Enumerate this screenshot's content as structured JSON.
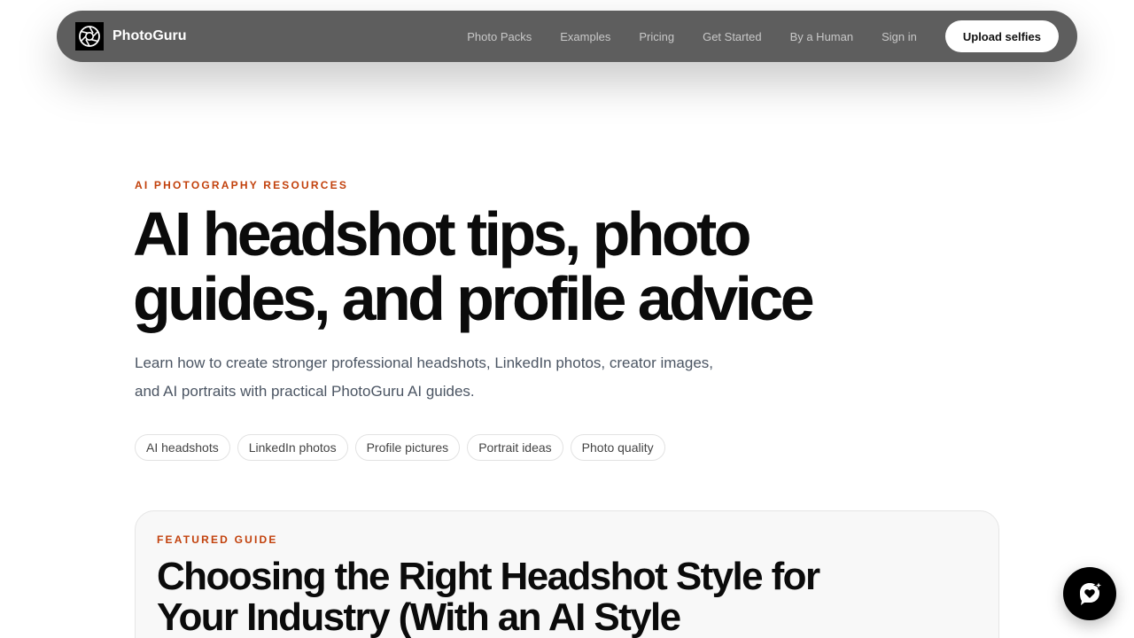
{
  "nav": {
    "brand": "PhotoGuru",
    "links": [
      "Photo Packs",
      "Examples",
      "Pricing",
      "Get Started",
      "By a Human",
      "Sign in"
    ],
    "cta": "Upload selfies"
  },
  "hero": {
    "eyebrow": "AI PHOTOGRAPHY RESOURCES",
    "title": "AI headshot tips, photo guides, and profile advice",
    "subtitle": "Learn how to create stronger professional headshots, LinkedIn photos, creator images, and AI portraits with practical PhotoGuru AI guides.",
    "tags": [
      "AI headshots",
      "LinkedIn photos",
      "Profile pictures",
      "Portrait ideas",
      "Photo quality"
    ]
  },
  "featured": {
    "eyebrow": "FEATURED GUIDE",
    "title": "Choosing the Right Headshot Style for Your Industry (With an AI Style"
  },
  "icons": {
    "logo": "aperture-icon",
    "chat": "chat-heart-sparkle-icon"
  },
  "colors": {
    "accent": "#c2410c",
    "nav_bg": "#5e5e5e"
  }
}
